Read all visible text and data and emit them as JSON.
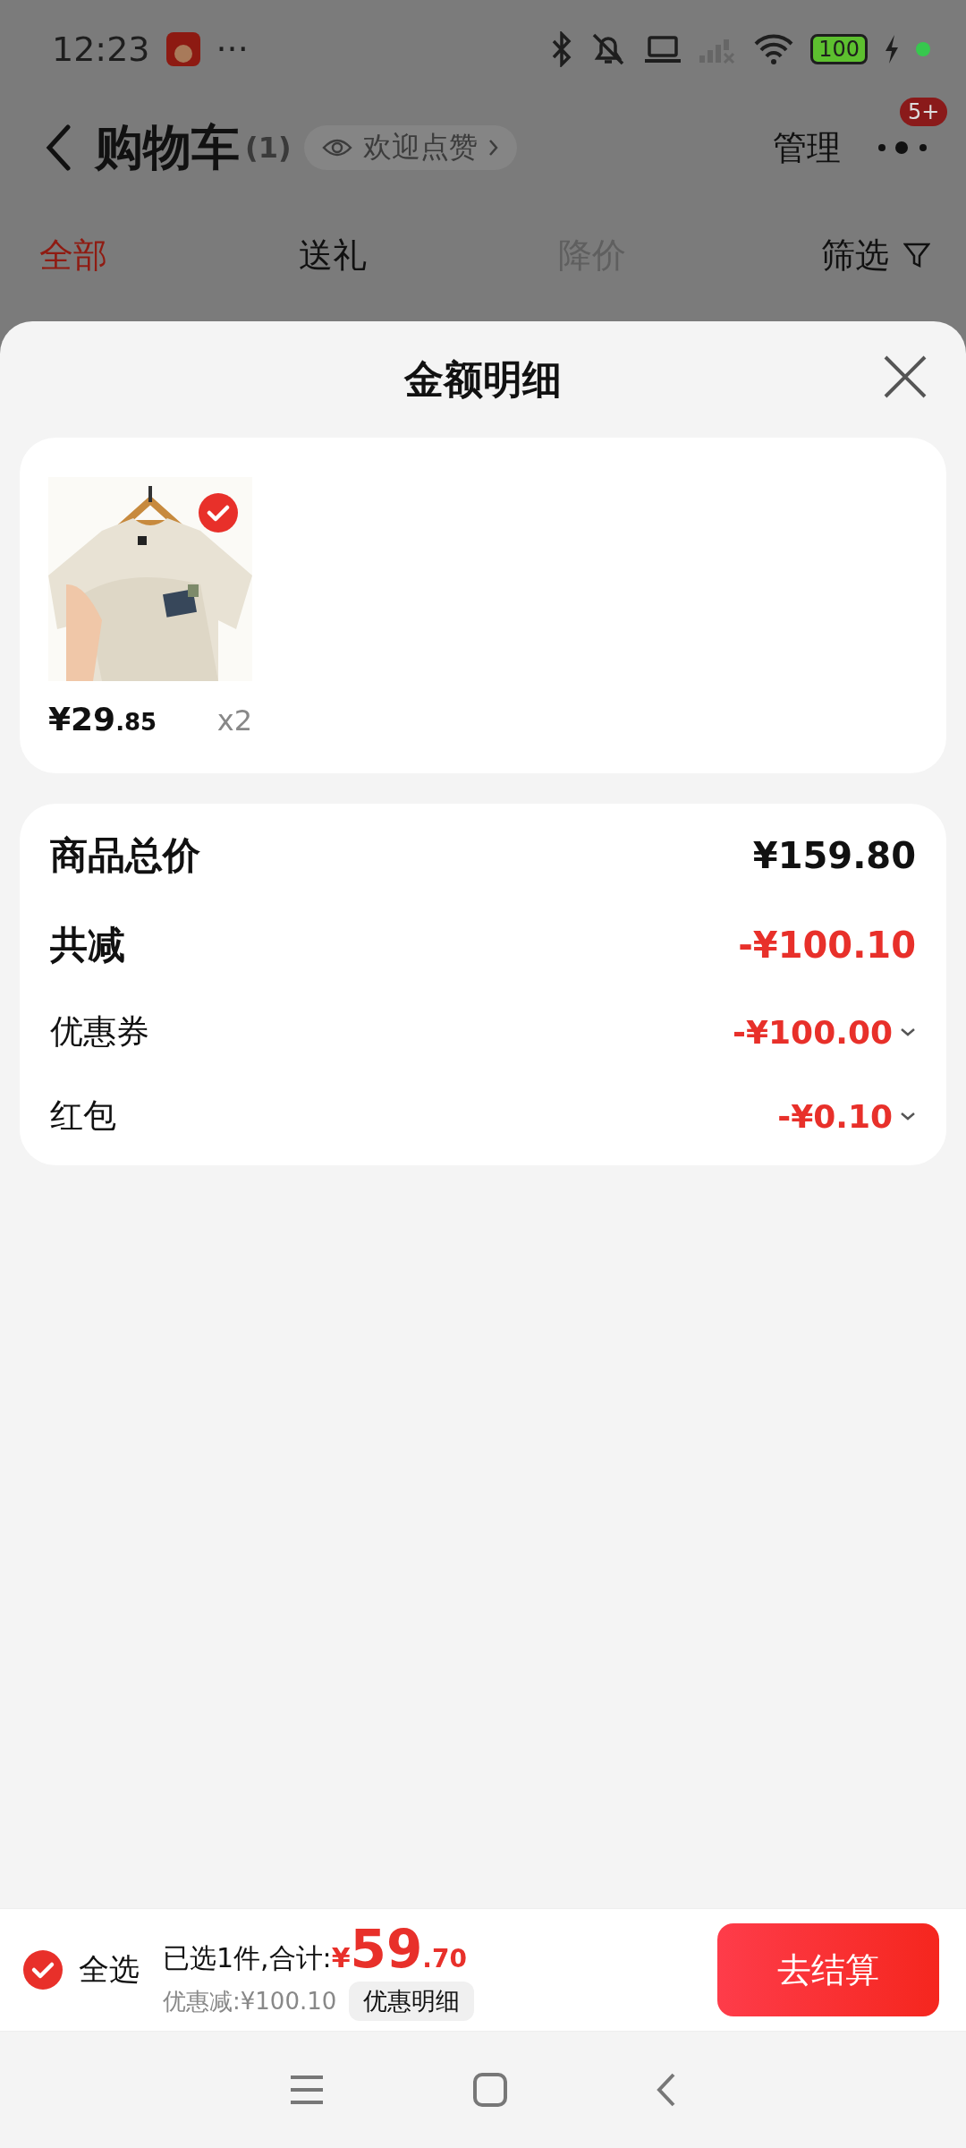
{
  "status_bar": {
    "time": "12:23",
    "more": "···",
    "battery": "100"
  },
  "header": {
    "title": "购物车",
    "count": "(1)",
    "like_chip": "欢迎点赞",
    "manage": "管理",
    "badge": "5+"
  },
  "tabs": [
    {
      "label": "全部",
      "selected": true,
      "disabled": false
    },
    {
      "label": "送礼",
      "selected": false,
      "disabled": false
    },
    {
      "label": "降价",
      "selected": false,
      "disabled": true
    }
  ],
  "filter": "筛选",
  "sheet": {
    "title": "金额明细",
    "items": [
      {
        "kind": "picture",
        "checked": true,
        "price_integer": "¥29",
        "price_decimal": ".85",
        "quantity": "x2"
      }
    ],
    "rows": [
      {
        "kind": "main",
        "label": "商品总价",
        "value": "¥159.80",
        "negative": false
      },
      {
        "kind": "main",
        "label": "共减",
        "value": "-¥100.10",
        "negative": true
      },
      {
        "kind": "detail",
        "label": "优惠券",
        "value": "-¥100.00",
        "negative": true
      },
      {
        "kind": "detail",
        "label": "红包",
        "value": "-¥0.10",
        "negative": true
      }
    ]
  },
  "bottom_bar": {
    "select_all": {
      "label": "全选",
      "checked": true
    },
    "selected_text": "已选1件,合计:",
    "currency": "¥",
    "total_integer": "59",
    "total_decimal": ".70",
    "discount": "优惠减:¥100.10",
    "detail_button": "优惠明细",
    "checkout": "去结算"
  }
}
